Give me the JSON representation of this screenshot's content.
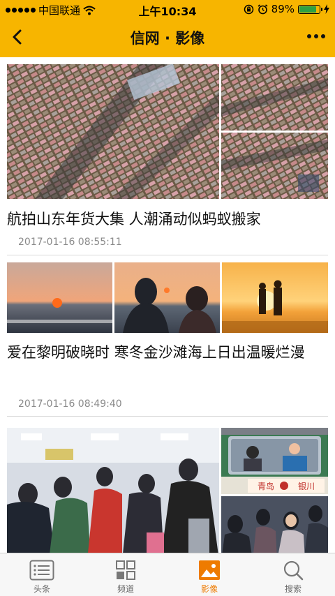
{
  "status_bar": {
    "carrier": "中国联通",
    "time": "上午10:34",
    "battery": "89%"
  },
  "nav": {
    "title": "信网 · 影像"
  },
  "articles": [
    {
      "title": "航拍山东年货大集 人潮涌动似蚂蚁搬家",
      "time": "2017-01-16 08:55:11"
    },
    {
      "title": "爱在黎明破晓时 寒冬金沙滩海上日出温暖烂漫",
      "time": "2017-01-16 08:49:40"
    },
    {
      "sign_left": "青岛",
      "sign_right": "银川"
    }
  ],
  "tabs": [
    {
      "label": "头条",
      "icon": "news-list-icon"
    },
    {
      "label": "频道",
      "icon": "channels-grid-icon"
    },
    {
      "label": "影像",
      "icon": "image-icon"
    },
    {
      "label": "搜索",
      "icon": "search-icon"
    }
  ],
  "colors": {
    "accent": "#f7b500",
    "active_tab": "#ee7b00"
  }
}
